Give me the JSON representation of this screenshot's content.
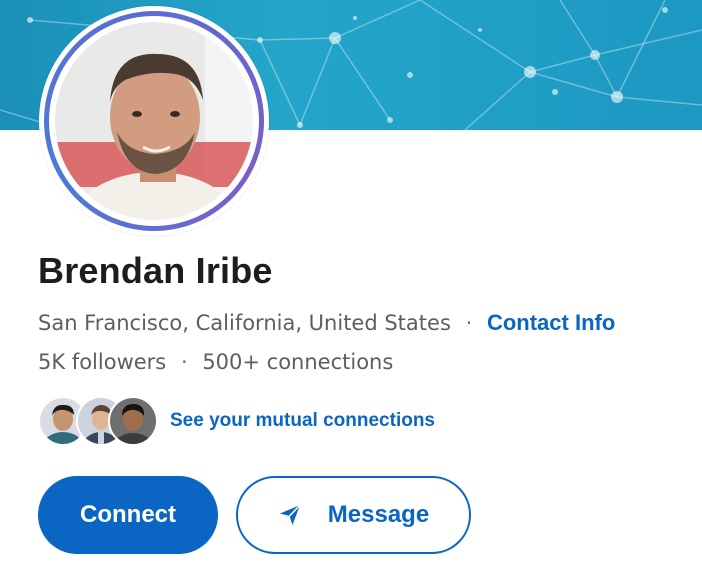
{
  "profile": {
    "name": "Brendan Iribe",
    "location": "San Francisco, California, United States",
    "contact_info_label": "Contact Info",
    "followers": "5K followers",
    "connections": "500+ connections",
    "separator": "·"
  },
  "mutual": {
    "label": "See your mutual connections"
  },
  "actions": {
    "connect_label": "Connect",
    "message_label": "Message"
  },
  "colors": {
    "accent": "#0a66c2",
    "banner": "#1c98c3",
    "text_primary": "#1d1d1d",
    "text_secondary": "#5e5e5e"
  },
  "icons": {
    "avatar": "profile-photo",
    "message": "send-icon"
  }
}
